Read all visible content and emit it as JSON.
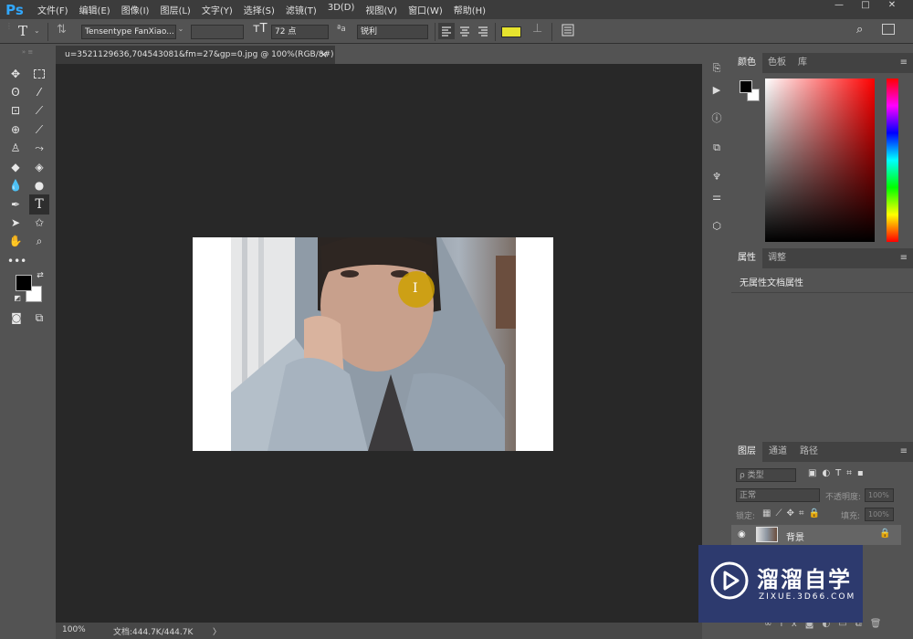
{
  "app": {
    "logo": "Ps"
  },
  "menu": [
    "文件(F)",
    "编辑(E)",
    "图像(I)",
    "图层(L)",
    "文字(Y)",
    "选择(S)",
    "滤镜(T)",
    "3D(D)",
    "视图(V)",
    "窗口(W)",
    "帮助(H)"
  ],
  "window_controls": {
    "minimize": "—",
    "maximize": "□",
    "close": "✕"
  },
  "options": {
    "font_family": "Tensentype FanXiao...",
    "font_size": "72 点",
    "aa_icon_label": "ªa",
    "antialias": "锐利",
    "text_color": "#e7e42e"
  },
  "document": {
    "tab_title": "u=3521129636,704543081&fm=27&gp=0.jpg @ 100%(RGB/8#)",
    "tab_close": "×",
    "zoom": "100%",
    "doc_info": "文档:444.7K/444.7K",
    "status_arrow": "〉",
    "cursor_glyph": "Ⅰ"
  },
  "panels": {
    "color_tabs": [
      "颜色",
      "色板",
      "库"
    ],
    "properties_tabs": [
      "属性",
      "调整"
    ],
    "properties_text": "无属性文档属性",
    "layers_tabs": [
      "图层",
      "通道",
      "路径"
    ],
    "layer_filter": "ρ 类型",
    "blend_mode": "正常",
    "opacity_label": "不透明度:",
    "opacity_value": "100%",
    "lock_label": "锁定:",
    "fill_label": "填充:",
    "fill_value": "100%",
    "layer_name": "背景"
  },
  "watermark": {
    "title": "溜溜自学",
    "url": "ZIXUE.3D66.COM"
  },
  "colors": {
    "foreground": "#000000",
    "background": "#ffffff"
  }
}
